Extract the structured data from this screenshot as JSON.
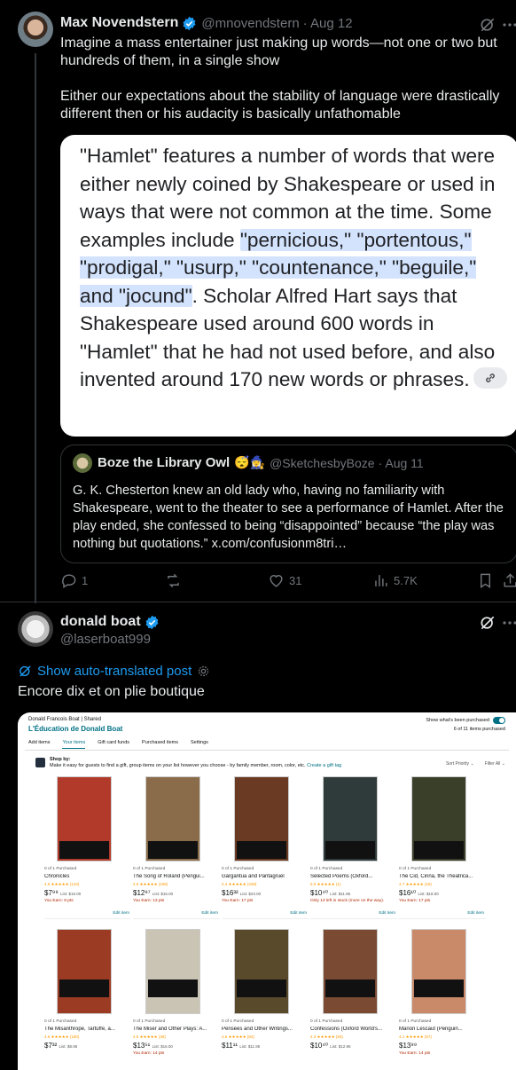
{
  "tweet1": {
    "name": "Max Novendstern",
    "handle": "@mnovendstern",
    "date": "· Aug 12",
    "text1": "Imagine a mass entertainer just making up words—not one or two but hundreds of them, in a single show",
    "text2": "Either our expectations about the stability of language were drastically different then or his audacity is basically unfathomable",
    "image_text": {
      "p1": "\"Hamlet\" features a number of words that were either newly coined by Shakespeare or used in ways that were not common at the time. Some examples include ",
      "highlight": "\"pernicious,\" \"portentous,\" \"prodigal,\" \"usurp,\" \"countenance,\" \"beguile,\" and \"jocund\"",
      "p2": ". Scholar Alfred Hart says that Shakespeare used around 600 words in \"Hamlet\" that he had not used before, and also invented around 170 new words or phrases."
    },
    "quote": {
      "name": "Boze the Library Owl",
      "emoji": "😴🧙‍♀️",
      "handle": "@SketchesbyBoze",
      "date": "· Aug 11",
      "text": "G. K. Chesterton knew an old lady who, having no familiarity with Shakespeare, went to the theater to see a performance of Hamlet. After the play ended, she confessed to being “disappointed” because “the play was nothing but quotations.” x.com/confusionm8tri…"
    },
    "actions": {
      "replies": "1",
      "retweets": "",
      "likes": "31",
      "views": "5.7K"
    }
  },
  "tweet2": {
    "name": "donald boat",
    "handle": "@laserboat999",
    "translate": "Show auto-translated post",
    "text": "Encore dix et on plie boutique"
  },
  "amazon": {
    "breadcrumb": "Donald Francois Boat | Shared",
    "list_title": "L'Éducation de Donald Boat",
    "tabs": [
      "Add items",
      "Your items",
      "Gift card funds",
      "Purchased items",
      "Settings"
    ],
    "show_purchased": "Show what's been purchased",
    "count": "6 of 11 items purchased",
    "shop_by_title": "Shop by:",
    "shop_by_text": "Make it easy for guests to find a gift, group items on your list however you choose - by family member, room, color, etc.",
    "create_tag": "Create a gift tag",
    "sort": "Sort  Priority ⌄",
    "filter": "Filter  All ⌄",
    "items": [
      {
        "purchased": "0 of 1 Purchased",
        "title": "Chronicles",
        "rating": "4.6 ★★★★★ (143)",
        "price": "$7⁹⁹",
        "list": "List: $16.00",
        "note": "You Earn: 8 pts",
        "edit": "Edit item",
        "cover": "#b13a2a"
      },
      {
        "purchased": "0 of 1 Purchased",
        "title": "The Song of Roland (Pengui...",
        "rating": "4.5 ★★★★★ (196)",
        "price": "$12⁹⁷",
        "list": "List: $16.00",
        "note": "You Earn: 13 pts",
        "edit": "Edit item",
        "cover": "#8a6b4a"
      },
      {
        "purchased": "0 of 1 Purchased",
        "title": "Gargantua and Pantagruel",
        "rating": "4.4 ★★★★★ (438)",
        "price": "$16³²",
        "list": "List: $23.00",
        "note": "You Earn: 17 pts",
        "edit": "Edit item",
        "cover": "#6b3a22"
      },
      {
        "purchased": "0 of 1 Purchased",
        "title": "Selected Poems (Oxford...",
        "rating": "5.0 ★★★★★ (1)",
        "price": "$10⁴⁰",
        "list": "List: $11.95",
        "note": "Only 13 left in stock (more on the way).",
        "edit": "Edit item",
        "cover": "#2e3b3a"
      },
      {
        "purchased": "0 of 1 Purchased",
        "title": "The Cid, Cinna, the Theatrica...",
        "rating": "4.7 ★★★★★ (19)",
        "price": "$16¹⁰",
        "list": "List: $18.00",
        "note": "You Earn: 17 pts",
        "edit": "Edit item",
        "cover": "#3a3f2a"
      },
      {
        "purchased": "0 of 1 Purchased",
        "title": "The Misanthrope, Tartuffe, a...",
        "rating": "4.6 ★★★★★ (180)",
        "price": "$7³²",
        "list": "List: $8.95",
        "note": "",
        "edit": "",
        "cover": "#9c3b24"
      },
      {
        "purchased": "0 of 1 Purchased",
        "title": "The Miser and Other Plays: A...",
        "rating": "4.5 ★★★★★ (38)",
        "price": "$13⁵¹",
        "list": "List: $16.00",
        "note": "You Earn: 14 pts",
        "edit": "",
        "cover": "#c9c4b4"
      },
      {
        "purchased": "0 of 1 Purchased",
        "title": "Pensées and Other Writings...",
        "rating": "4.6 ★★★★★ (84)",
        "price": "$11¹¹",
        "list": "List: $11.95",
        "note": "",
        "edit": "",
        "cover": "#5a4a2c"
      },
      {
        "purchased": "0 of 1 Purchased",
        "title": "Confessions (Oxford World's...",
        "rating": "4.3 ★★★★★ (93)",
        "price": "$10⁴⁰",
        "list": "List: $12.95",
        "note": "",
        "edit": "",
        "cover": "#7a4b32"
      },
      {
        "purchased": "0 of 1 Purchased",
        "title": "Manon Lescaut (Penguin...",
        "rating": "4.1 ★★★★★ (57)",
        "price": "$13⁹⁹",
        "list": "",
        "note": "You Earn: 14 pts",
        "edit": "",
        "cover": "#c98a6a"
      }
    ]
  },
  "colors": {
    "accent": "#1d9bf0",
    "verified": "#1d9bf0",
    "highlight": "#d3e3fd",
    "amazon_link": "#007185"
  }
}
